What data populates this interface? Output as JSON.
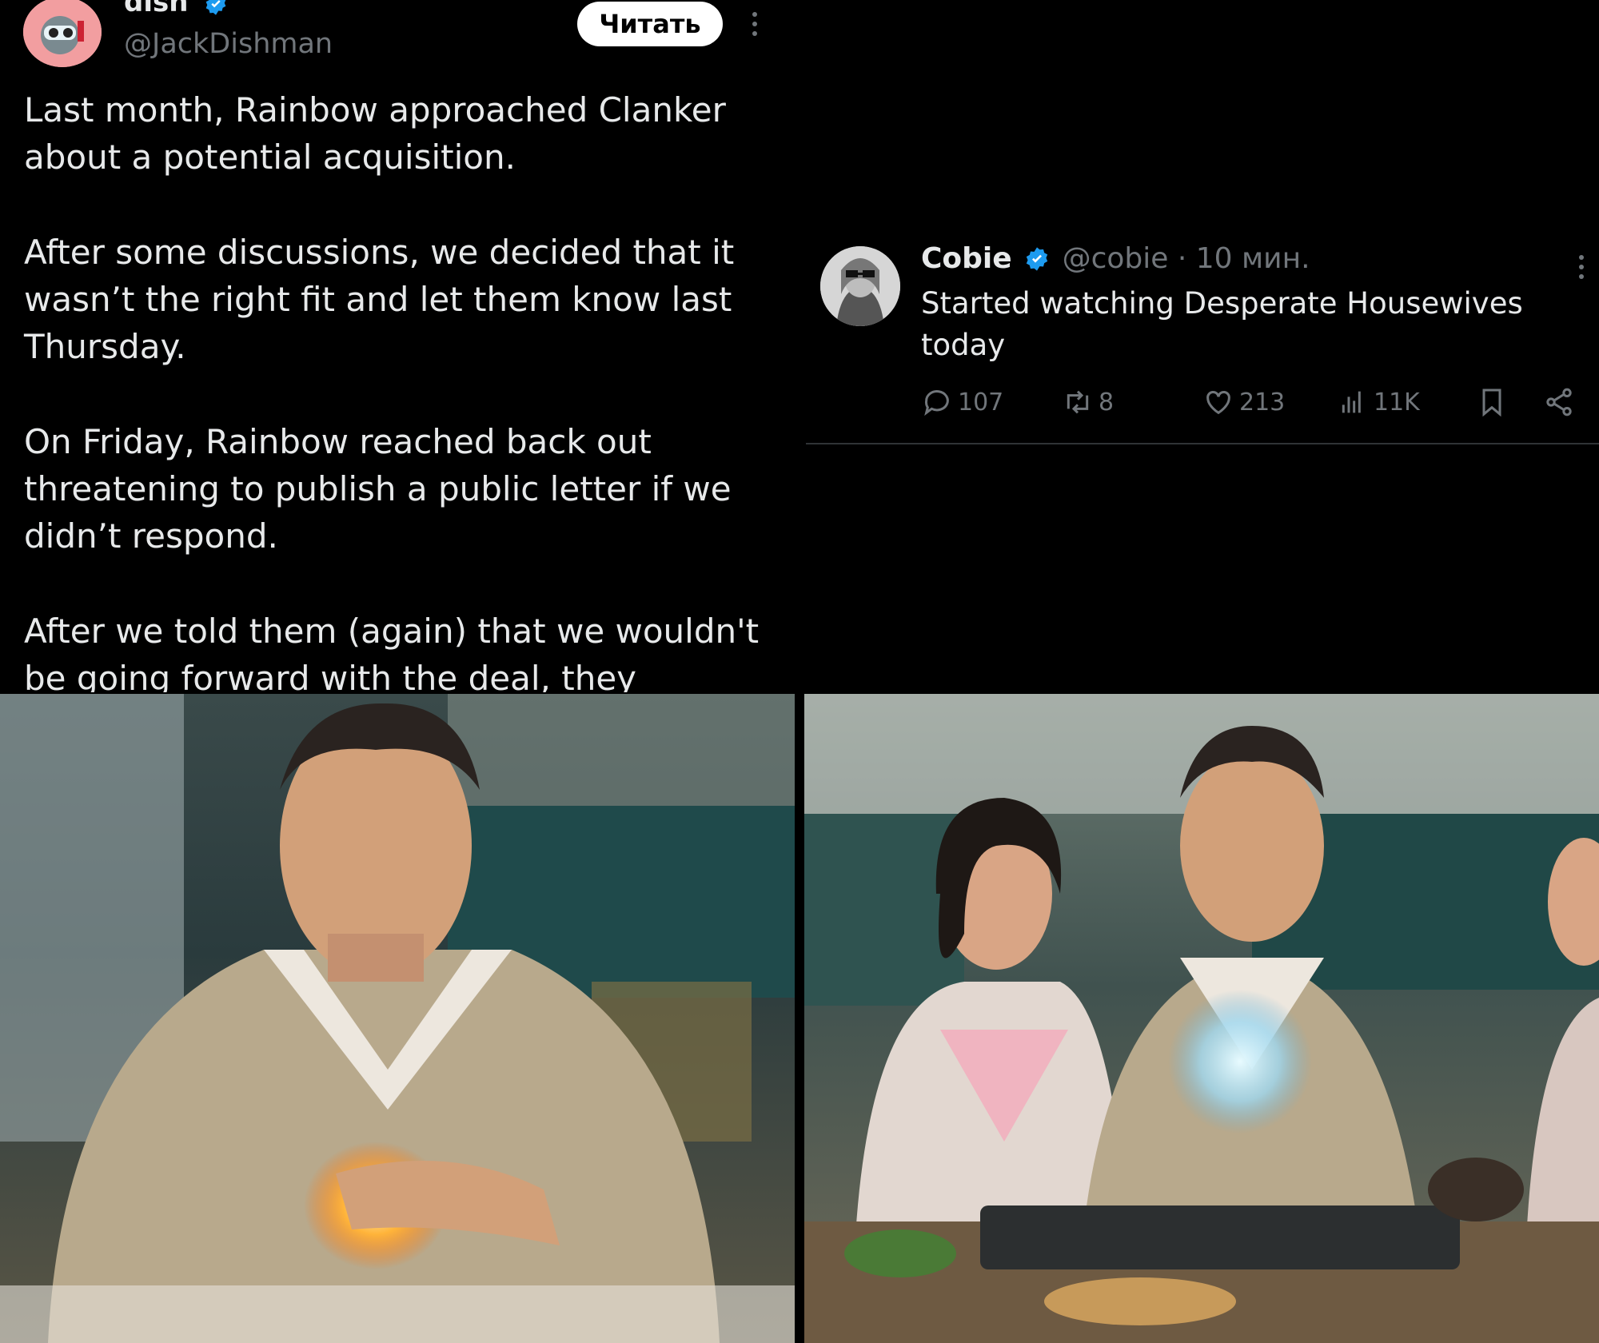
{
  "left_tweet": {
    "author_name": "dish",
    "author_handle": "@JackDishman",
    "read_button": "Читать",
    "paragraphs": [
      "Last month, Rainbow approached Clanker about a potential acquisition.",
      "After some discussions, we decided that it wasn’t the right fit and let them know last Thursday.",
      "On Friday, Rainbow reached back out threatening to publish a public letter if we didn’t respond.",
      "After we told them (again) that we wouldn't be going forward with the deal, they"
    ]
  },
  "right_tweet": {
    "author_name": "Cobie",
    "author_handle": "@cobie",
    "time": "· 10 мин.",
    "text": "Started watching Desperate Housewives today",
    "replies": "107",
    "reposts": "8",
    "likes": "213",
    "views": "11K"
  },
  "colors": {
    "background": "#000000",
    "text": "#e7e9ea",
    "muted": "#71767b",
    "verified": "#1d9bf0"
  },
  "icons": [
    "verified-badge-icon",
    "more-icon",
    "reply-icon",
    "repost-icon",
    "like-icon",
    "views-icon",
    "bookmark-icon",
    "share-icon"
  ]
}
